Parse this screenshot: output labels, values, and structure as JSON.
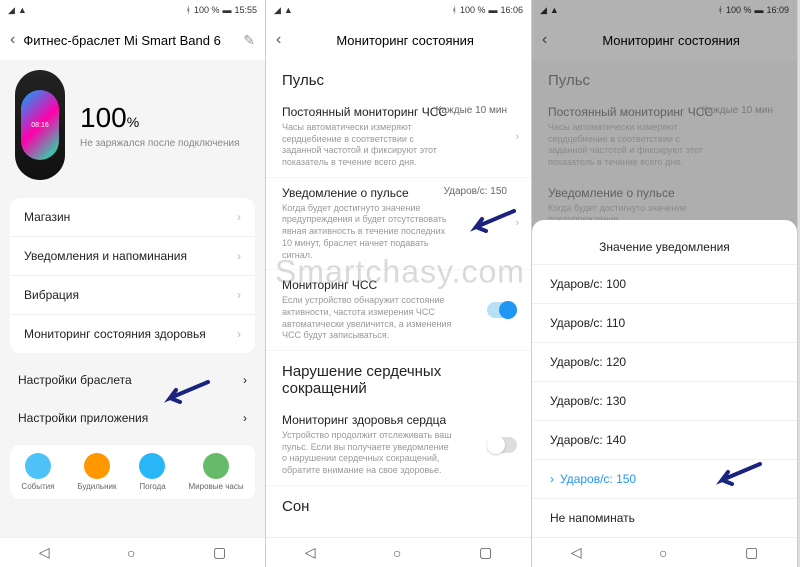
{
  "watermark": "Smartchasy.com",
  "phone1": {
    "status": {
      "battery": "100 %",
      "time": "15:55"
    },
    "title": "Фитнес-браслет Mi Smart Band 6",
    "band_time": "08:16",
    "battery_pct": "100",
    "battery_unit": "%",
    "battery_sub": "Не заряжался после подключения",
    "menu": [
      "Магазин",
      "Уведомления и напоминания",
      "Вибрация",
      "Мониторинг состояния здоровья"
    ],
    "extra": [
      "Настройки браслета",
      "Настройки приложения"
    ],
    "icons": [
      {
        "label": "События",
        "color": "#4fc3f7"
      },
      {
        "label": "Будильник",
        "color": "#ff9800"
      },
      {
        "label": "Погода",
        "color": "#29b6f6"
      },
      {
        "label": "Мировые часы",
        "color": "#66bb6a"
      }
    ]
  },
  "phone2": {
    "status": {
      "battery": "100 %",
      "time": "16:06"
    },
    "title": "Мониторинг состояния",
    "section": "Пульс",
    "items": [
      {
        "t": "Постоянный мониторинг ЧСС",
        "d": "Часы автоматически измеряют сердцебиение в соответствии с заданной частотой и фиксируют этот показатель в течение всего дня.",
        "v": "Каждые 10 мин",
        "chev": true
      },
      {
        "t": "Уведомление о пульсе",
        "d": "Когда будет достигнуто значение предупреждения и будет отсутствовать явная активность в течение последних 10 минут, браслет начнет подавать сигнал.",
        "v": "Ударов/с: 150",
        "chev": true
      },
      {
        "t": "Мониторинг ЧСС",
        "d": "Если устройство обнаружит состояние активности, частота измерения ЧСС автоматически увеличится, а изменения ЧСС будут записываться.",
        "toggle": "on"
      }
    ],
    "section2": "Нарушение сердечных сокращений",
    "items2": [
      {
        "t": "Мониторинг здоровья сердца",
        "d": "Устройство продолжит отслеживать ваш пульс. Если вы получаете уведомление о нарушении сердечных сокращений, обратите внимание на свое здоровье.",
        "toggle": "off"
      }
    ],
    "section3": "Сон"
  },
  "phone3": {
    "status": {
      "battery": "100 %",
      "time": "16:09"
    },
    "title": "Мониторинг состояния",
    "section": "Пульс",
    "items": [
      {
        "t": "Постоянный мониторинг ЧСС",
        "d": "Часы автоматически измеряют сердцебиение в соответствии с заданной частотой и фиксируют этот показатель в течение всего дня.",
        "v": "Каждые 10 мин"
      },
      {
        "t": "Уведомление о пульсе",
        "d": "Когда будет достигнуто значение предупреждения"
      }
    ],
    "sheet_title": "Значение уведомления",
    "options": [
      "Ударов/с: 100",
      "Ударов/с: 110",
      "Ударов/с: 120",
      "Ударов/с: 130",
      "Ударов/с: 140",
      "Ударов/с: 150",
      "Не напоминать"
    ],
    "selected_index": 5
  }
}
